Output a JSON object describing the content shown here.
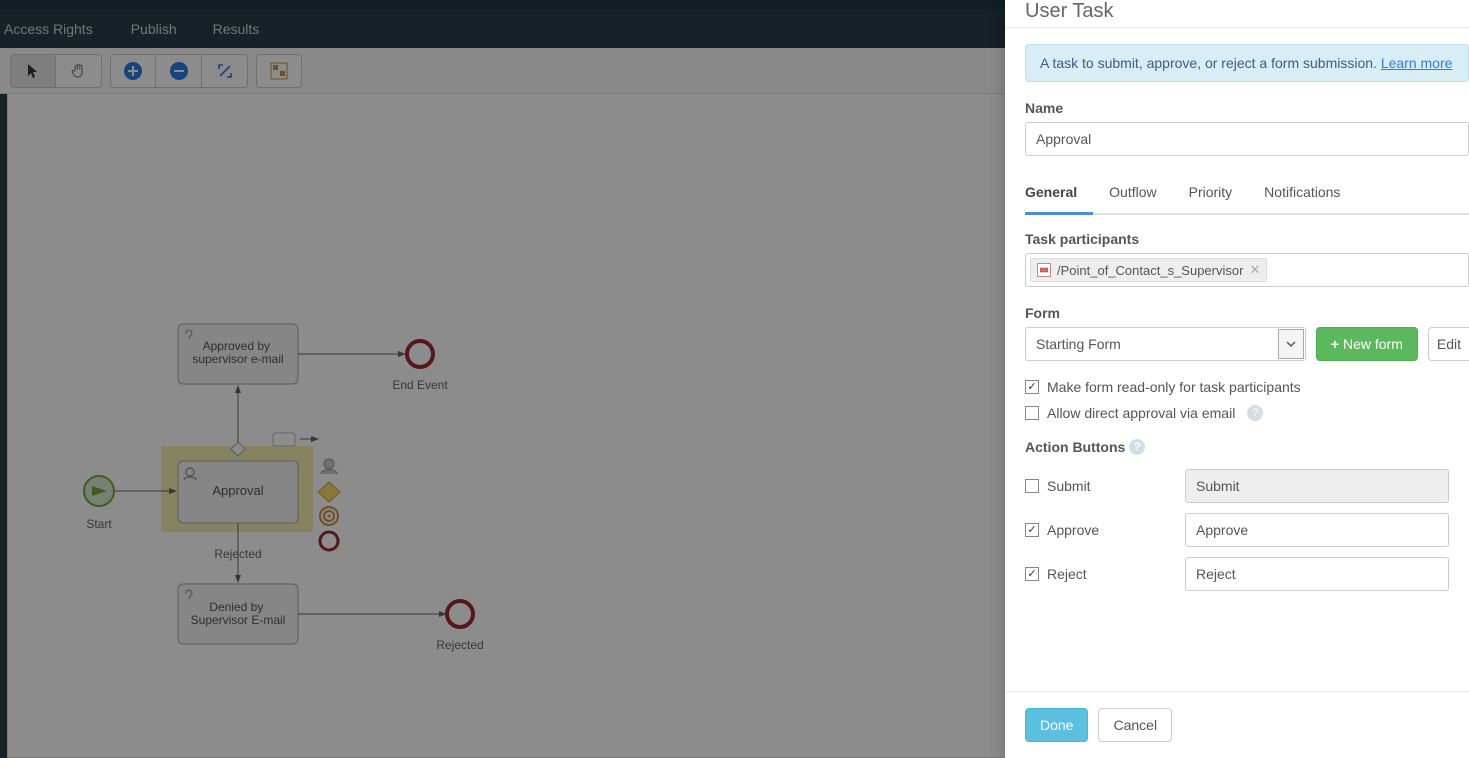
{
  "menubar": {
    "items": [
      "Access Rights",
      "Publish",
      "Results"
    ]
  },
  "diagram": {
    "start_label": "Start",
    "task_selected": "Approval",
    "task_approved": "Approved by supervisor e-mail",
    "task_denied": "Denied by Supervisor E-mail",
    "end_label_top": "End Event",
    "end_label_bottom": "Rejected",
    "branch_rejected": "Rejected"
  },
  "panel": {
    "title": "User Task",
    "info_text": "A task to submit, approve, or reject a form submission. ",
    "info_link": "Learn more",
    "name_label": "Name",
    "name_value": "Approval",
    "tabs": [
      "General",
      "Outflow",
      "Priority",
      "Notifications"
    ],
    "participants_label": "Task participants",
    "participants_tag": "/Point_of_Contact_s_Supervisor",
    "form_label": "Form",
    "form_value": "Starting Form",
    "new_form_btn": "New form",
    "edit_btn": "Edit",
    "readonly_label": "Make form read-only for task participants",
    "direct_approve_label": "Allow direct approval via email",
    "action_buttons_label": "Action Buttons",
    "actions": [
      {
        "key": "submit",
        "label": "Submit",
        "value": "Submit",
        "checked": false,
        "disabled": true
      },
      {
        "key": "approve",
        "label": "Approve",
        "value": "Approve",
        "checked": true,
        "disabled": false
      },
      {
        "key": "reject",
        "label": "Reject",
        "value": "Reject",
        "checked": true,
        "disabled": false
      }
    ],
    "done_btn": "Done",
    "cancel_btn": "Cancel"
  }
}
